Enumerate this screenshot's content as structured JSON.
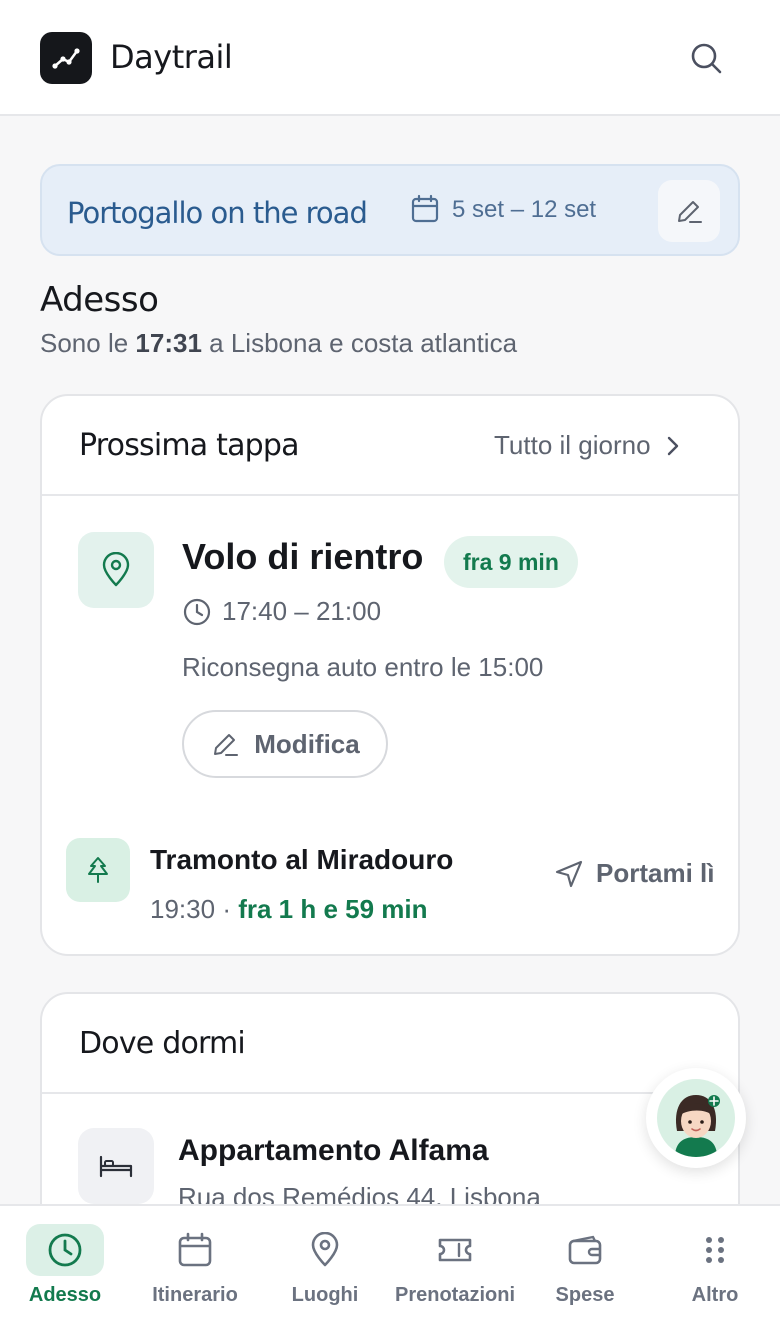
{
  "app": {
    "name": "Daytrail"
  },
  "trip": {
    "name": "Portogallo on the road",
    "dates": "5 set – 12 set"
  },
  "now": {
    "heading": "Adesso",
    "prefix": "Sono le",
    "time": "17:31",
    "suffix": "a Lisbona e costa atlantica"
  },
  "next_stop": {
    "header": "Prossima tappa",
    "all_day_label": "Tutto il giorno",
    "event": {
      "title": "Volo di rientro",
      "badge": "fra 9 min",
      "time": "17:40 – 21:00",
      "note": "Riconsegna auto entro le 15:00",
      "edit_label": "Modifica",
      "icon": "map-pin-icon"
    },
    "following": {
      "title": "Tramonto al Miradouro",
      "time": "19:30",
      "separator": "·",
      "relative": "fra 1 h e 59 min",
      "action_label": "Portami lì",
      "icon": "tree-icon"
    }
  },
  "sleep": {
    "header": "Dove dormi",
    "name": "Appartamento Alfama",
    "address": "Rua dos Remédios 44, Lisbona",
    "icon": "bed-icon"
  },
  "tabs": [
    {
      "label": "Adesso",
      "icon": "clock-icon",
      "active": true
    },
    {
      "label": "Itinerario",
      "icon": "calendar-icon",
      "active": false
    },
    {
      "label": "Luoghi",
      "icon": "map-pin-icon",
      "active": false
    },
    {
      "label": "Prenotazioni",
      "icon": "ticket-icon",
      "active": false
    },
    {
      "label": "Spese",
      "icon": "wallet-icon",
      "active": false
    },
    {
      "label": "Altro",
      "icon": "grid-dots-icon",
      "active": false
    }
  ],
  "colors": {
    "accent": "#137a4e",
    "trip_text": "#2a5b8f",
    "trip_bg": "#e6eef8"
  }
}
